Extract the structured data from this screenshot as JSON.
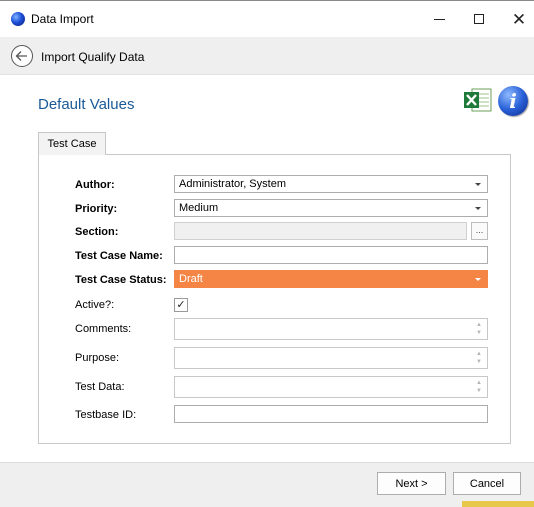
{
  "window": {
    "title": "Data Import",
    "close_glyph": "✕"
  },
  "header": {
    "title": "Import Qualify Data"
  },
  "section": {
    "title": "Default Values"
  },
  "tabs": [
    {
      "label": "Test Case"
    }
  ],
  "form": {
    "author": {
      "label": "Author:",
      "value": "Administrator, System"
    },
    "priority": {
      "label": "Priority:",
      "value": "Medium"
    },
    "section": {
      "label": "Section:",
      "value": "",
      "browse_label": "..."
    },
    "test_case_name": {
      "label": "Test Case Name:",
      "value": ""
    },
    "test_case_status": {
      "label": "Test Case Status:",
      "value": "Draft"
    },
    "active": {
      "label": "Active?:",
      "checked": true,
      "check_glyph": "✓"
    },
    "comments": {
      "label": "Comments:",
      "value": ""
    },
    "purpose": {
      "label": "Purpose:",
      "value": ""
    },
    "test_data": {
      "label": "Test Data:",
      "value": ""
    },
    "testbase_id": {
      "label": "Testbase ID:",
      "value": ""
    }
  },
  "buttons": {
    "next": "Next >",
    "cancel": "Cancel"
  },
  "icons": {
    "excel": "excel-icon",
    "info": "info-icon",
    "info_glyph": "i",
    "back": "back-arrow-icon"
  },
  "colors": {
    "accent": "#1a5a97",
    "draft_status": "#f58545"
  }
}
